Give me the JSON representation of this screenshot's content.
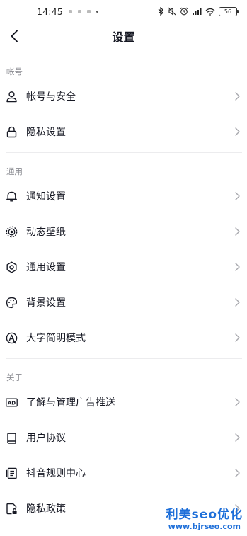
{
  "status_bar": {
    "time": "14:45",
    "battery": "56"
  },
  "header": {
    "title": "设置"
  },
  "sections": {
    "account": "帐号",
    "general": "通用",
    "about": "关于"
  },
  "items": {
    "account_security": "帐号与安全",
    "privacy_settings": "隐私设置",
    "notification_settings": "通知设置",
    "live_wallpaper": "动态壁纸",
    "general_settings": "通用设置",
    "background_settings": "背景设置",
    "large_font_mode": "大字简明模式",
    "ad_management": "了解与管理广告推送",
    "user_agreement": "用户协议",
    "rules_center": "抖音规则中心",
    "privacy_policy": "隐私政策"
  },
  "watermark": {
    "title": "利美seo优化",
    "url": "www.bjrseo.com"
  },
  "colors": {
    "accent": "#1e6fd9",
    "text": "#161823",
    "muted": "#8a8b91"
  }
}
